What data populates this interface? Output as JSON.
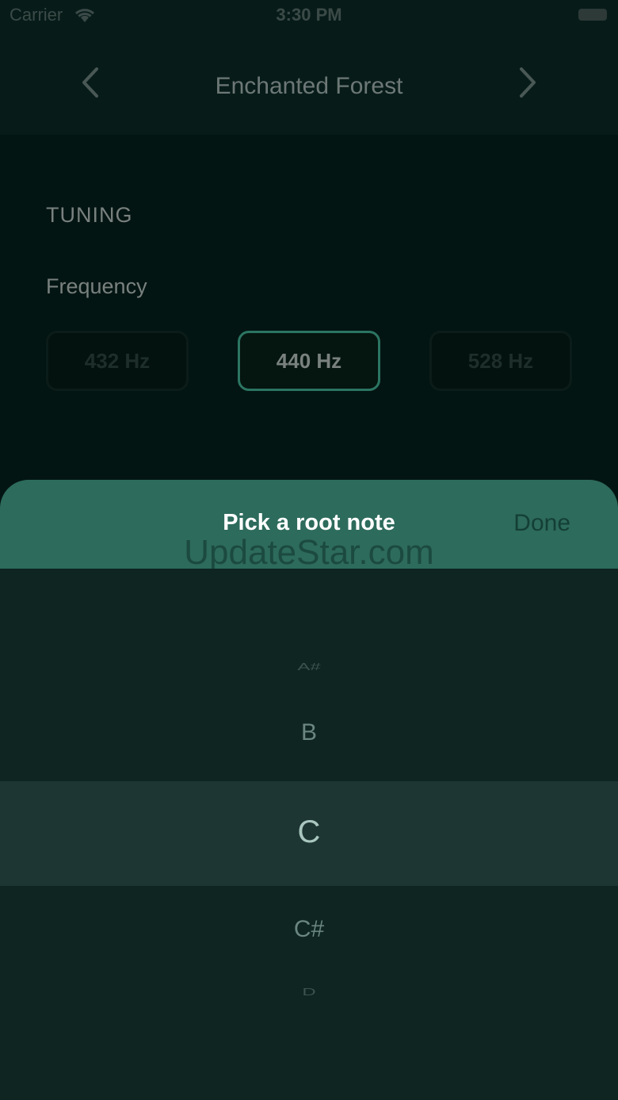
{
  "status_bar": {
    "carrier": "Carrier",
    "time": "3:30 PM"
  },
  "nav": {
    "title": "Enchanted Forest",
    "prev_icon": "chevron-left-icon",
    "next_icon": "chevron-right-icon"
  },
  "tuning": {
    "section_title": "TUNING",
    "frequency_label": "Frequency",
    "options": [
      "432 Hz",
      "440 Hz",
      "528 Hz"
    ],
    "selected": "440 Hz"
  },
  "sheet": {
    "title": "Pick a root note",
    "done_label": "Done",
    "watermark": "UpdateStar.com"
  },
  "picker": {
    "items": [
      "A#",
      "B",
      "C",
      "C#",
      "D"
    ],
    "selected": "C"
  },
  "colors": {
    "accent": "#2d6b5c",
    "background": "#031512",
    "picker_bg": "#0e2522"
  }
}
